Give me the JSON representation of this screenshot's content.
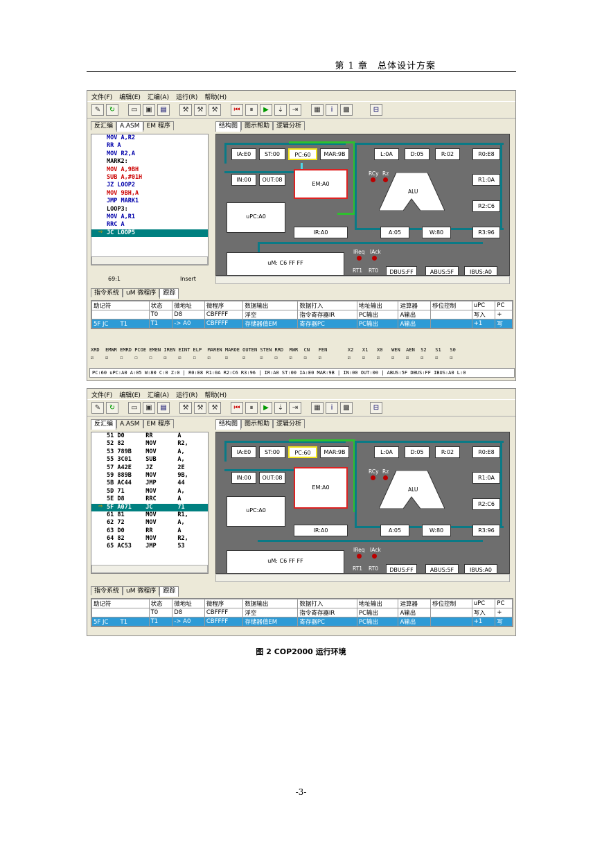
{
  "header": {
    "chapter": "第 1 章　总体设计方案"
  },
  "menu": [
    "文件(F)",
    "编辑(E)",
    "汇编(A)",
    "运行(R)",
    "帮助(H)"
  ],
  "left_tabs": [
    "反汇编",
    "A.ASM",
    "EM 程序"
  ],
  "right_tabs": [
    "结构图",
    "图示帮助",
    "逻辑分析"
  ],
  "bottom_tabs": [
    "指令系统",
    "uM 微程序",
    "跟踪"
  ],
  "code1": [
    "MOV A,R2",
    "RR A",
    "MOV R2,A",
    "MARK2:",
    "MOV A,9BH",
    "SUB A,#01H",
    "JZ LOOP2",
    "MOV 9BH,A",
    "JMP MARK1",
    "LOOP3:",
    "MOV A,R1",
    "RRC A",
    "JC LOOP5"
  ],
  "code2": [
    "51 D0      RR       A",
    "52 82      MOV      R2,",
    "53 789B    MOV      A,",
    "55 3C01    SUB      A,",
    "57 A42E    JZ       2E",
    "59 889B    MOV      9B,",
    "5B AC44    JMP      44",
    "5D 71      MOV      A,",
    "5E D8      RRC      A",
    "5F A071    JC       71",
    "61 81      MOV      R1,",
    "62 72      MOV      A,",
    "63 D0      RR       A",
    "64 82      MOV      R2,",
    "65 AC53    JMP      53"
  ],
  "status_pos": "69:1",
  "status_mode": "Insert",
  "regs": {
    "ia": "IA:E0",
    "st": "ST:00",
    "pc": "PC:60",
    "mar": "MAR:9B",
    "l": "L:0A",
    "d": "D:05",
    "r": "R:02",
    "r0": "R0:E8",
    "in": "IN:00",
    "out": "OUT:08",
    "em": "EM:A0",
    "r1": "R1:0A",
    "alu": "ALU",
    "r2": "R2:C6",
    "upc": "uPC:A0",
    "ir": "IR:A0",
    "a": "A:05",
    "w": "W:80",
    "r3": "R3:96",
    "um": "uM: C6 FF FF",
    "dbus": "DBUS:FF",
    "abus": "ABUS:5F",
    "ibus": "IBUS:A0",
    "rcy": "RCy",
    "rz": "Rz",
    "ireq": "IReq",
    "iack": "IAck",
    "rt1": "RT1",
    "rt0": "RT0"
  },
  "grid_headers": [
    "助记符",
    "状态",
    "微地址",
    "微程序",
    "数据输出",
    "数据打入",
    "地址输出",
    "运算器",
    "移位控制",
    "uPC",
    "PC"
  ],
  "grid_rows1": [
    [
      "",
      "T0",
      "D8",
      "CBFFFF",
      "浮空",
      "指令寄存器IR",
      "PC输出",
      "A输出",
      "",
      "写入",
      "+"
    ],
    [
      "5F JC　　T1",
      "T1",
      "-> A0",
      "CBFFFF",
      "存储器值EM",
      "寄存器PC",
      "PC输出",
      "A输出",
      "",
      "+1",
      "写"
    ]
  ],
  "grid_rows2": [
    [
      "",
      "T0",
      "D8",
      "CBFFFF",
      "浮空",
      "指令寄存器IR",
      "PC输出",
      "A输出",
      "",
      "写入",
      "+"
    ],
    [
      "5F JC　　T1",
      "T1",
      "-> A0",
      "CBFFFF",
      "存储器值EM",
      "寄存器PC",
      "PC输出",
      "A输出",
      "",
      "+1",
      "写"
    ]
  ],
  "signals": "XRD  EMWR EMRD PCOE EMEN IREN EINT ELP  MAREN MAROE OUTEN STEN RRD  RWR  CN   FEN       X2   X1   X0   WEN  AEN  S2   S1   S0",
  "checks": "☑    ☑    ☐    ☐    ☐    ☑    ☑    ☐    ☑     ☑     ☑     ☑    ☑    ☑    ☑    ☑         ☑    ☑    ☑    ☑    ☑    ☑    ☑    ☑",
  "statusline": "PC:60  uPC:A0  A:05  W:80  C:0 Z:0 | R0:E8  R1:0A  R2:C6  R3:96 | IR:A0  ST:00  IA:E0 MAR:9B | IN:00 OUT:00 | ABUS:5F  DBUS:FF  IBUS:A0  L:0",
  "caption": "图 2  COP2000 运行环境",
  "page": "-3-"
}
